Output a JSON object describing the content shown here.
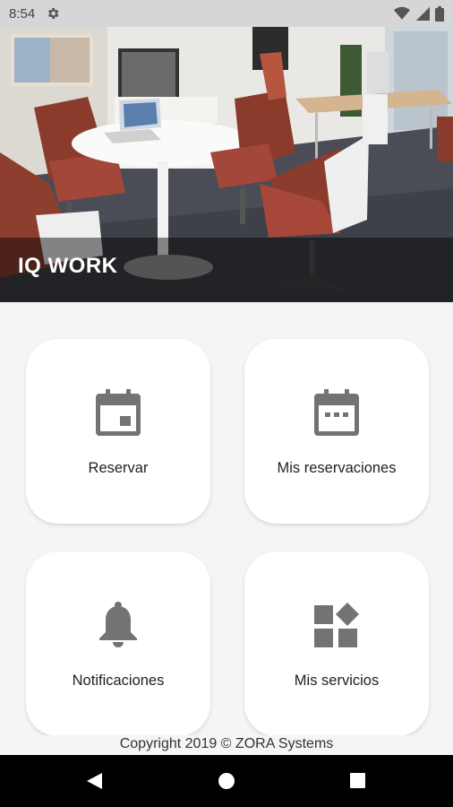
{
  "status_bar": {
    "time": "8:54",
    "icons": [
      "settings-icon",
      "wifi-icon",
      "signal-icon",
      "battery-icon"
    ]
  },
  "hero": {
    "title": "IQ WORK",
    "image": "office-lounge-photo"
  },
  "menu": {
    "reservar": {
      "label": "Reservar",
      "icon": "calendar-today-icon"
    },
    "mis_reservaciones": {
      "label": "Mis reservaciones",
      "icon": "calendar-dots-icon"
    },
    "notificaciones": {
      "label": "Notificaciones",
      "icon": "bell-icon"
    },
    "mis_servicios": {
      "label": "Mis servicios",
      "icon": "widgets-icon"
    }
  },
  "footer": {
    "copyright": "Copyright 2019 © ZORA Systems"
  },
  "nav_bar": {
    "buttons": [
      "back-icon",
      "home-icon",
      "recents-icon"
    ]
  },
  "colors": {
    "status_bar": "#d6d6d6",
    "background": "#f5f5f5",
    "card": "#ffffff",
    "icon_gray": "#737373",
    "nav_bar": "#000000"
  }
}
